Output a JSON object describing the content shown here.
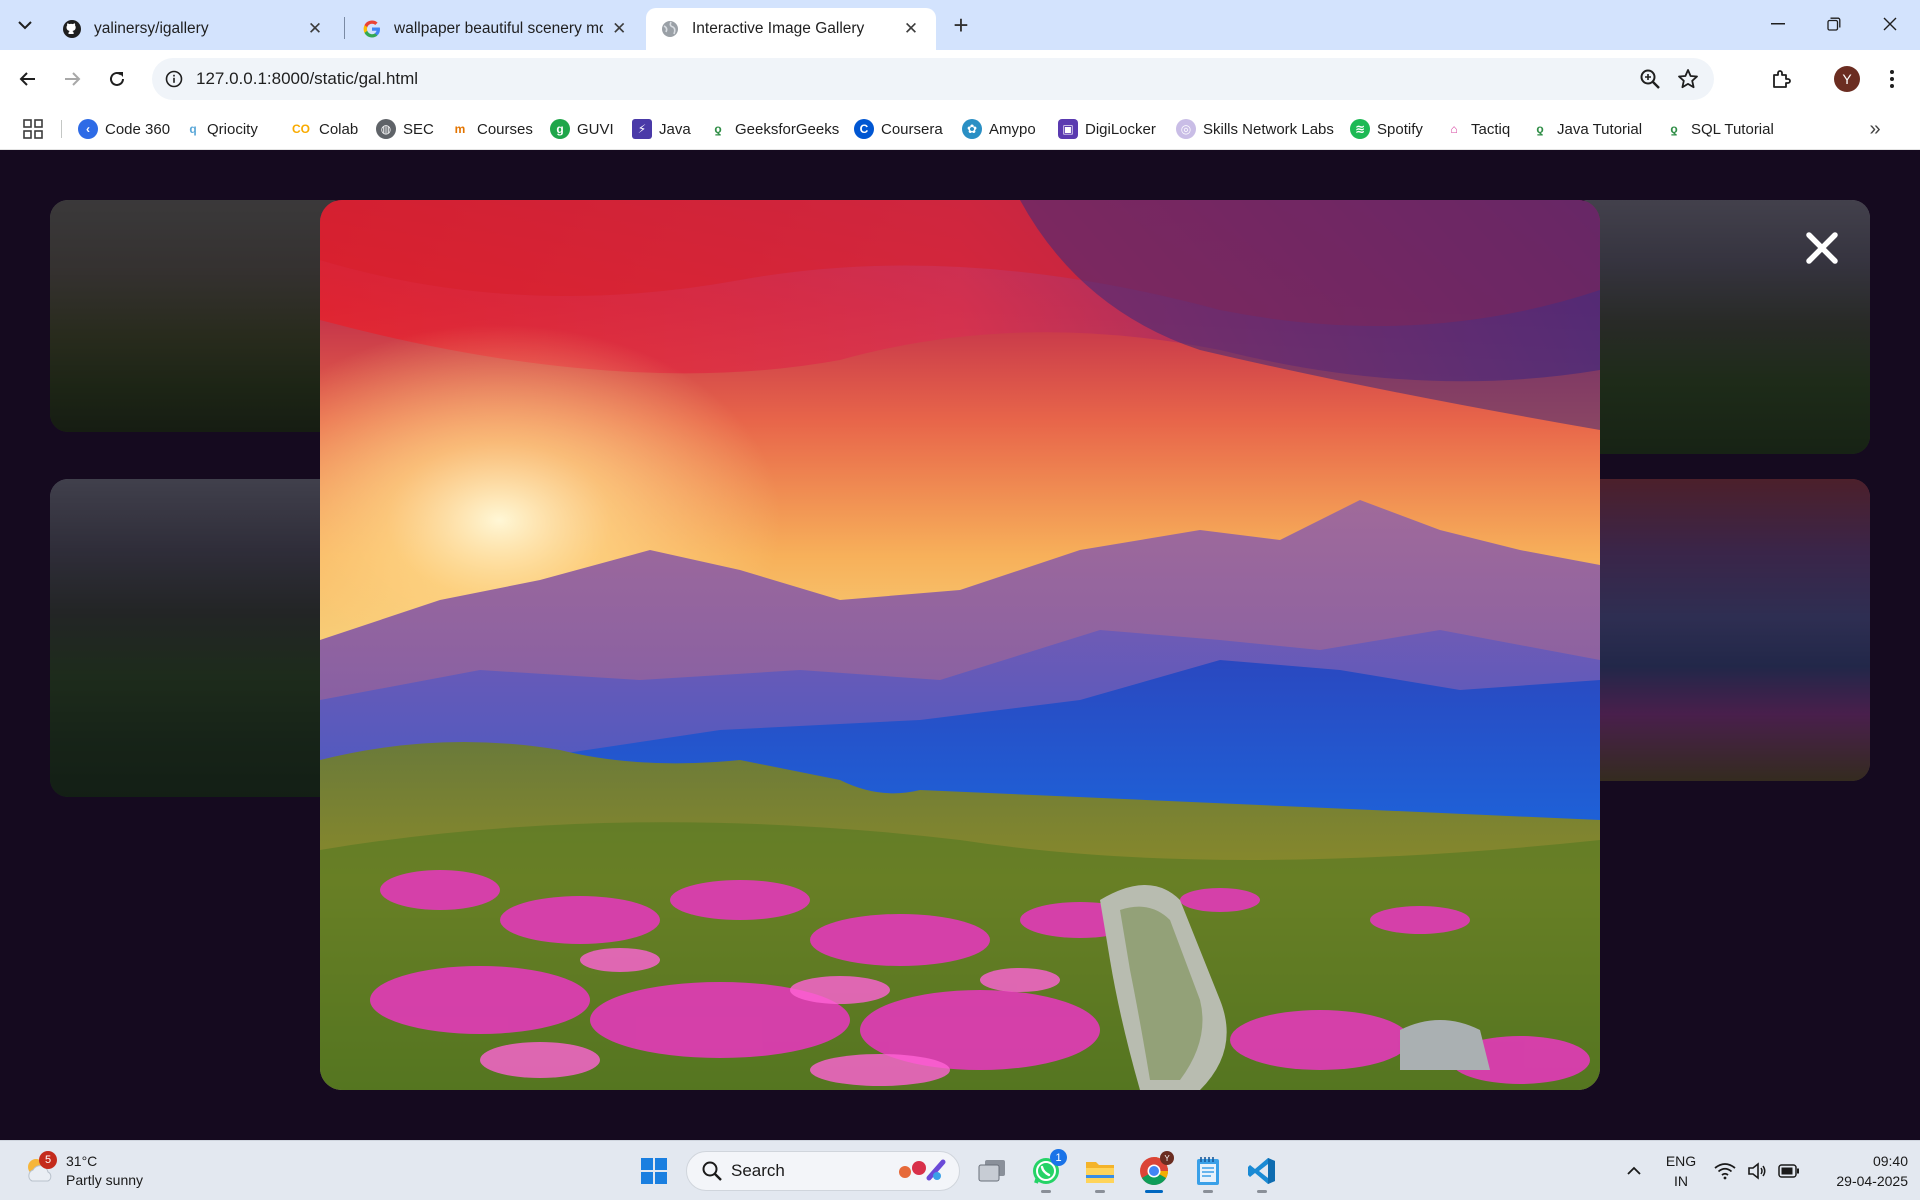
{
  "browser": {
    "tabs": [
      {
        "title": "yalinersy/igallery",
        "favicon": "github-icon",
        "active": false
      },
      {
        "title": "wallpaper beautiful scenery mo",
        "favicon": "google-icon",
        "active": false
      },
      {
        "title": "Interactive Image Gallery",
        "favicon": "globe-icon",
        "active": true
      }
    ],
    "url": "127.0.0.1:8000/static/gal.html",
    "profile_initial": "Y",
    "bookmarks": [
      {
        "label": "Code 360",
        "icon": "code360-icon",
        "color": "#2e6be6"
      },
      {
        "label": "Qriocity",
        "icon": "qriocity-icon",
        "color": "#5aa7d8"
      },
      {
        "label": "Colab",
        "icon": "colab-icon",
        "color": "#f9ab00"
      },
      {
        "label": "SEC",
        "icon": "globe-icon",
        "color": "#5f6368"
      },
      {
        "label": "Courses",
        "icon": "courses-icon",
        "color": "#e37400"
      },
      {
        "label": "GUVI",
        "icon": "guvi-icon",
        "color": "#1fa64a"
      },
      {
        "label": "Java",
        "icon": "java-icon",
        "color": "#4a3aa8"
      },
      {
        "label": "GeeksforGeeks",
        "icon": "gfg-icon",
        "color": "#2f8d46"
      },
      {
        "label": "Coursera",
        "icon": "coursera-icon",
        "color": "#0056d2"
      },
      {
        "label": "Amypo",
        "icon": "amypo-icon",
        "color": "#2a8fc4"
      },
      {
        "label": "DigiLocker",
        "icon": "digilocker-icon",
        "color": "#5a3ab0"
      },
      {
        "label": "Skills Network Labs",
        "icon": "skills-icon",
        "color": "#9b87c9"
      },
      {
        "label": "Spotify",
        "icon": "spotify-icon",
        "color": "#1db954"
      },
      {
        "label": "Tactiq",
        "icon": "tactiq-icon",
        "color": "#d6409f"
      },
      {
        "label": "Java Tutorial",
        "icon": "gfg-icon",
        "color": "#2f8d46"
      },
      {
        "label": "SQL Tutorial",
        "icon": "gfg-icon",
        "color": "#2f8d46"
      }
    ]
  },
  "gallery": {
    "close_symbol": "✕",
    "thumbnails": [
      "thumbnail-mountain-meadow",
      "thumbnail-alpine-peaks",
      "thumbnail-forest-valley",
      "thumbnail-sunset-flowers"
    ],
    "lightbox_image": "sunset-mountains-flowers-image"
  },
  "taskbar": {
    "weather_temp": "31°C",
    "weather_desc": "Partly sunny",
    "weather_badge": "5",
    "search_label": "Search",
    "whatsapp_badge": "1",
    "lang_line1": "ENG",
    "lang_line2": "IN",
    "time": "09:40",
    "date": "29-04-2025"
  }
}
